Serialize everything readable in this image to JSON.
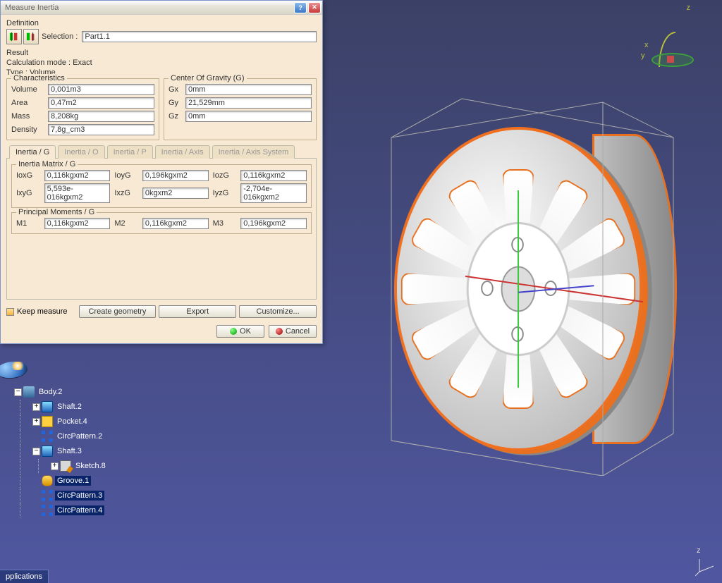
{
  "dialog": {
    "title": "Measure Inertia",
    "definition": {
      "label": "Definition",
      "selection_label": "Selection :",
      "selection_value": "Part1.1"
    },
    "result": {
      "label": "Result",
      "calc_mode_line": "Calculation mode :  Exact",
      "type_line": "Type :  Volume"
    },
    "characteristics": {
      "legend": "Characteristics",
      "volume_label": "Volume",
      "volume_value": "0,001m3",
      "area_label": "Area",
      "area_value": "0,47m2",
      "mass_label": "Mass",
      "mass_value": "8,208kg",
      "density_label": "Density",
      "density_value": "7,8g_cm3"
    },
    "cog": {
      "legend": "Center Of Gravity (G)",
      "gx_label": "Gx",
      "gx_value": "0mm",
      "gy_label": "Gy",
      "gy_value": "21,529mm",
      "gz_label": "Gz",
      "gz_value": "0mm"
    },
    "tabs": {
      "g": "Inertia / G",
      "o": "Inertia / O",
      "p": "Inertia / P",
      "axis": "Inertia / Axis",
      "axis_sys": "Inertia / Axis System"
    },
    "inertia_matrix": {
      "legend": "Inertia Matrix / G",
      "ioxg_k": "IoxG",
      "ioxg_v": "0,116kgxm2",
      "ioyg_k": "IoyG",
      "ioyg_v": "0,196kgxm2",
      "iozg_k": "IozG",
      "iozg_v": "0,116kgxm2",
      "ixyg_k": "IxyG",
      "ixyg_v": "5,593e-016kgxm2",
      "ixzg_k": "IxzG",
      "ixzg_v": "0kgxm2",
      "iyzg_k": "IyzG",
      "iyzg_v": "-2,704e-016kgxm2"
    },
    "principal": {
      "legend": "Principal Moments / G",
      "m1_k": "M1",
      "m1_v": "0,116kgxm2",
      "m2_k": "M2",
      "m2_v": "0,116kgxm2",
      "m3_k": "M3",
      "m3_v": "0,196kgxm2"
    },
    "keep_measure": "Keep measure",
    "create_geometry": "Create geometry",
    "export": "Export",
    "customize": "Customize...",
    "ok": "OK",
    "cancel": "Cancel"
  },
  "tree": {
    "body": "Body.2",
    "shaft2": "Shaft.2",
    "pocket4": "Pocket.4",
    "circ2": "CircPattern.2",
    "shaft3": "Shaft.3",
    "sketch8": "Sketch.8",
    "groove1": "Groove.1",
    "circ3": "CircPattern.3",
    "circ4": "CircPattern.4"
  },
  "viewport": {
    "compass": {
      "x": "x",
      "y": "y",
      "z": "z"
    },
    "axis_z": "z"
  },
  "app_button": "pplications"
}
